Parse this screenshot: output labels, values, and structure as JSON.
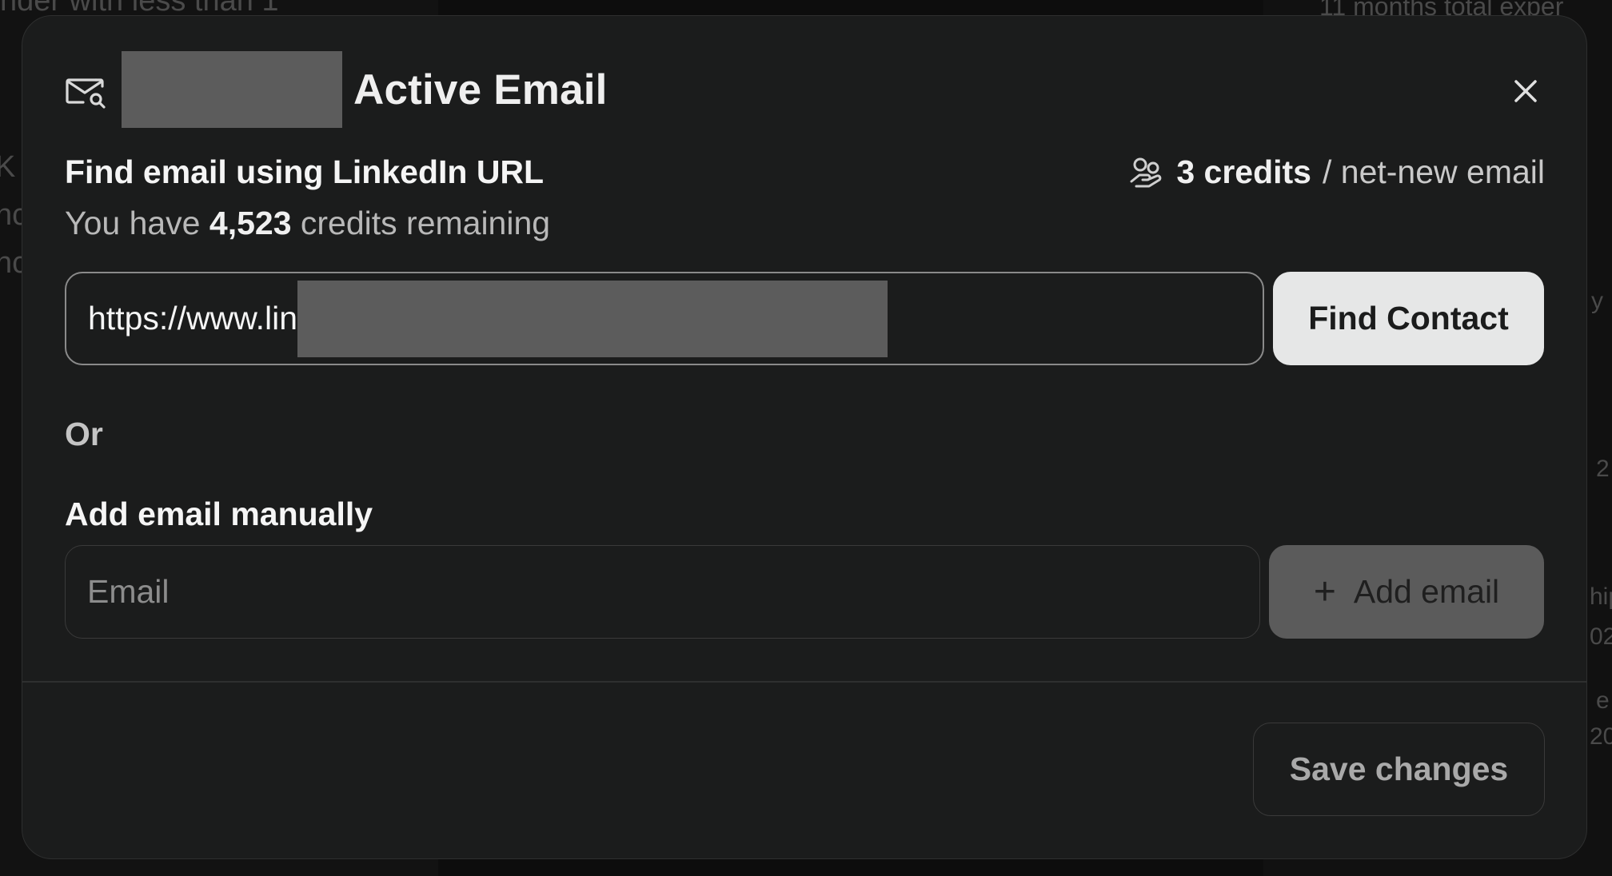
{
  "background": {
    "top_left_text": "nder with less than 1",
    "top_right_text": "11 months total exper",
    "left_fragments": [
      "K",
      "nc",
      "nc"
    ],
    "right_fragments": [
      "y",
      "2",
      "hip",
      "02",
      "e",
      "20"
    ]
  },
  "modal": {
    "title": "Active Email",
    "icon": "mail-search-icon",
    "close_icon": "close-icon",
    "section_title": "Find email using LinkedIn URL",
    "credits_prefix": "You have ",
    "credits_remaining": "4,523",
    "credits_suffix": " credits remaining",
    "cost_icon": "coin-hand-icon",
    "cost_bold": "3 credits",
    "cost_rest": "/ net-new email",
    "url_value": "https://www.lin",
    "find_button": "Find Contact",
    "or_label": "Or",
    "manual_title": "Add email manually",
    "email_placeholder": "Email",
    "email_value": "",
    "add_button_icon": "plus-icon",
    "add_button": "Add email",
    "save_button": "Save changes"
  },
  "colors": {
    "modal_bg": "#1b1c1c",
    "primary_button_bg": "#e6e7e7",
    "disabled_button_bg": "#5b5b5b",
    "redaction": "#5c5c5c"
  }
}
